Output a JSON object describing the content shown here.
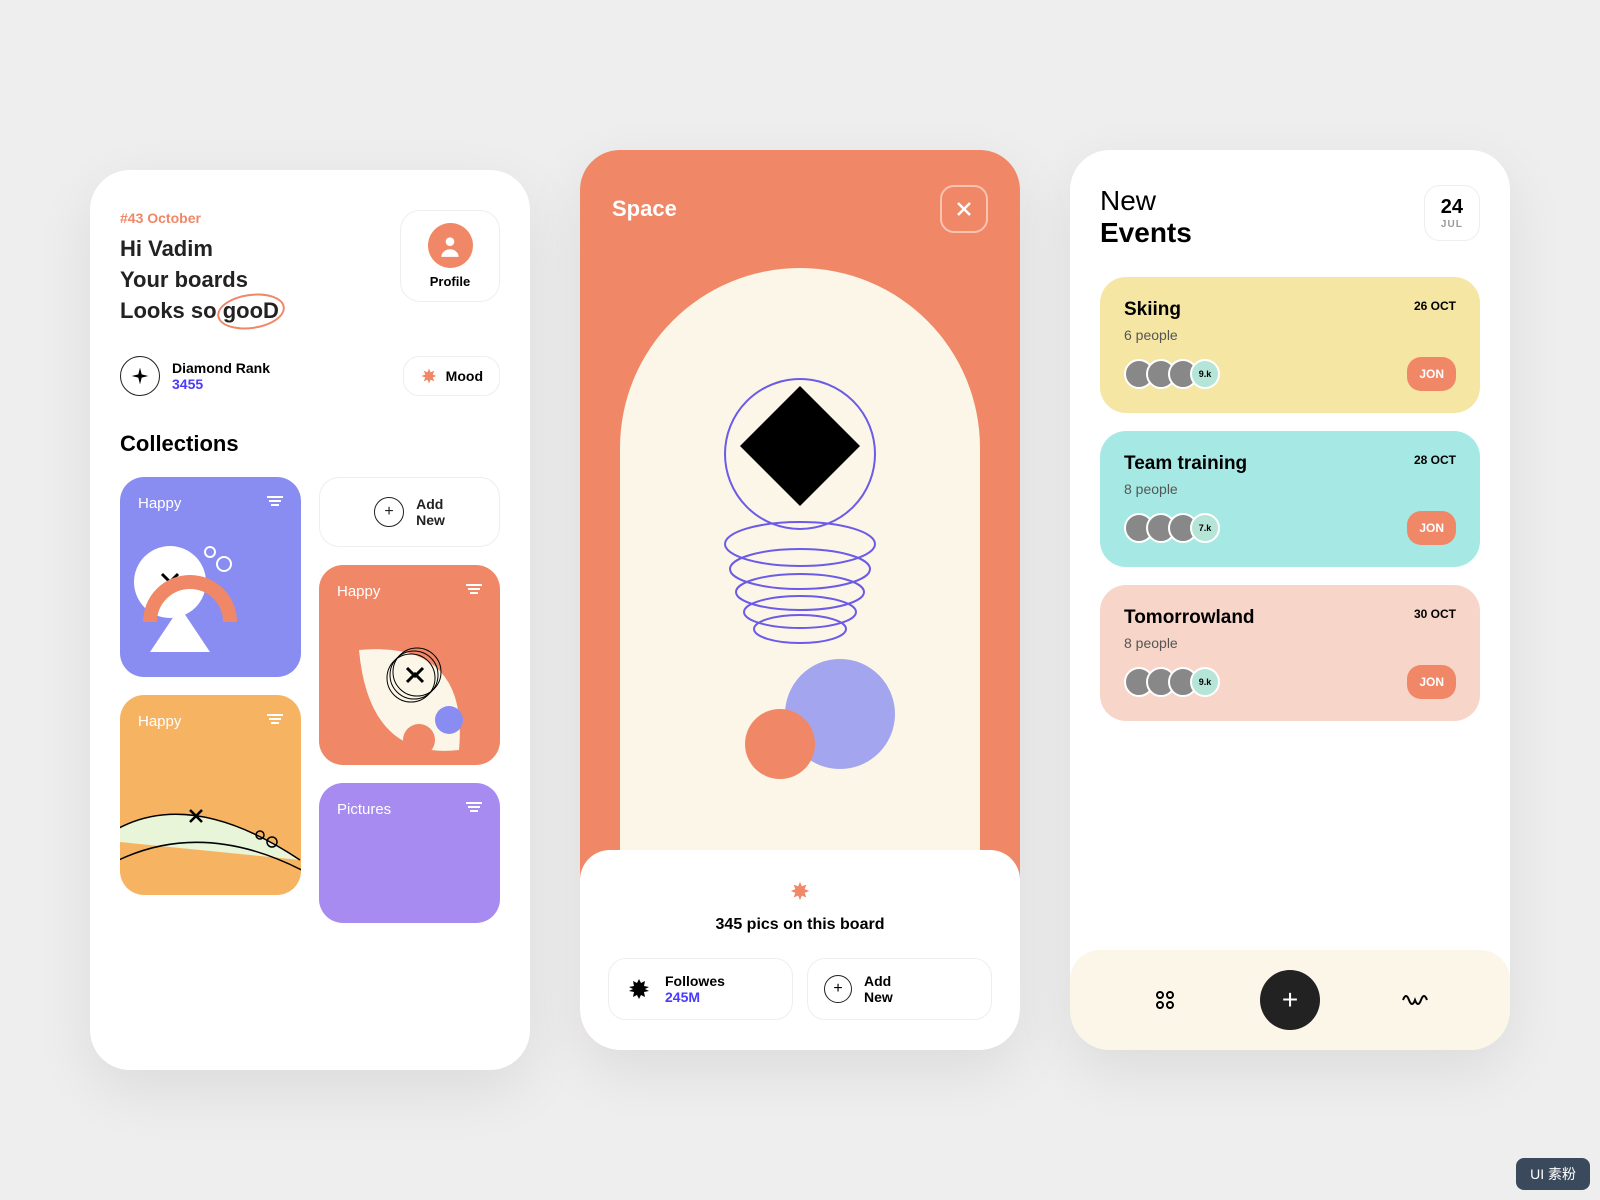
{
  "screen1": {
    "tag": "#43 October",
    "greeting_l1": "Hi Vadim",
    "greeting_l2": "Your boards",
    "greeting_l3_prefix": "Looks so ",
    "greeting_l3_highlight": "gooD",
    "profile_label": "Profile",
    "rank_label": "Diamond Rank",
    "rank_value": "3455",
    "mood_label": "Mood",
    "collections_title": "Collections",
    "add_label_l1": "Add",
    "add_label_l2": "New",
    "cards": {
      "c1": "Happy",
      "c2": "Happy",
      "c3": "Happy",
      "c4": "Pictures"
    }
  },
  "screen2": {
    "title": "Space",
    "pics_text": "345 pics on this board",
    "followers_label": "Followes",
    "followers_value": "245M",
    "add_label_l1": "Add",
    "add_label_l2": "New"
  },
  "screen3": {
    "title_l1": "New",
    "title_l2": "Events",
    "date_num": "24",
    "date_month": "JUL",
    "events": [
      {
        "title": "Skiing",
        "date": "26 OCT",
        "people": "6 people",
        "badge": "9.k",
        "action": "JON"
      },
      {
        "title": "Team training",
        "date": "28 OCT",
        "people": "8 people",
        "badge": "7.k",
        "action": "JON"
      },
      {
        "title": "Tomorrowland",
        "date": "30 OCT",
        "people": "8 people",
        "badge": "9.k",
        "action": "JON"
      }
    ]
  },
  "watermark": "UI 素粉"
}
